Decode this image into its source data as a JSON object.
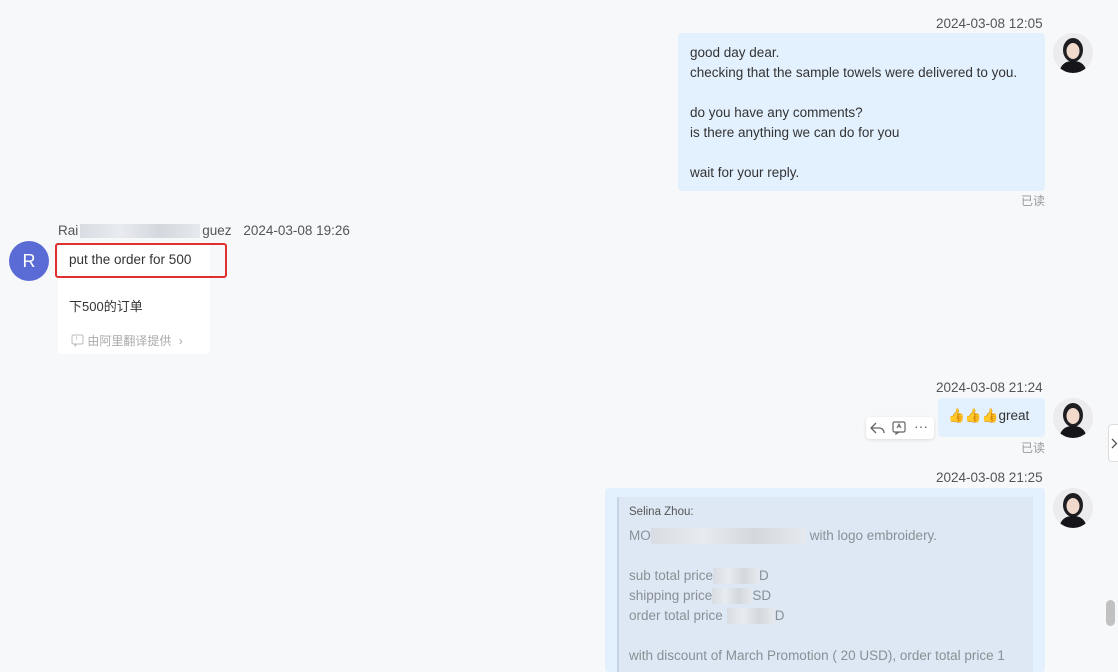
{
  "messages": {
    "m1": {
      "timestamp": "2024-03-08 12:05",
      "lines": [
        "good day dear.",
        "checking that the sample towels were delivered to you.",
        "",
        "do you have any comments?",
        "is there anything we can do for you",
        "",
        "wait for your reply."
      ],
      "read_status": "已读"
    },
    "m2": {
      "sender_start": "Rai",
      "sender_end": "guez",
      "timestamp": "2024-03-08 19:26",
      "avatar_letter": "R",
      "text": "put the order for 500",
      "translation": "下500的订单",
      "translation_provider": "由阿里翻译提供"
    },
    "m3": {
      "timestamp": "2024-03-08 21:24",
      "emoji": "👍👍👍",
      "text": "great",
      "read_status": "已读"
    },
    "m4": {
      "timestamp": "2024-03-08 21:25",
      "quote_author": "Selina Zhou:",
      "line1_start": "MO",
      "line1_end": "with logo embroidery.",
      "sub_total": "sub total price",
      "sub_total_end": "D",
      "shipping": "shipping price",
      "shipping_end": "SD",
      "order_total": "order total price",
      "order_total_end": "D",
      "discount": "with discount of March Promotion ( 20 USD), order total price 1"
    }
  },
  "colors": {
    "outgoing_bubble": "#e3f0fe",
    "avatar_r": "#5b6bd5",
    "highlight_box": "#e0302d"
  }
}
